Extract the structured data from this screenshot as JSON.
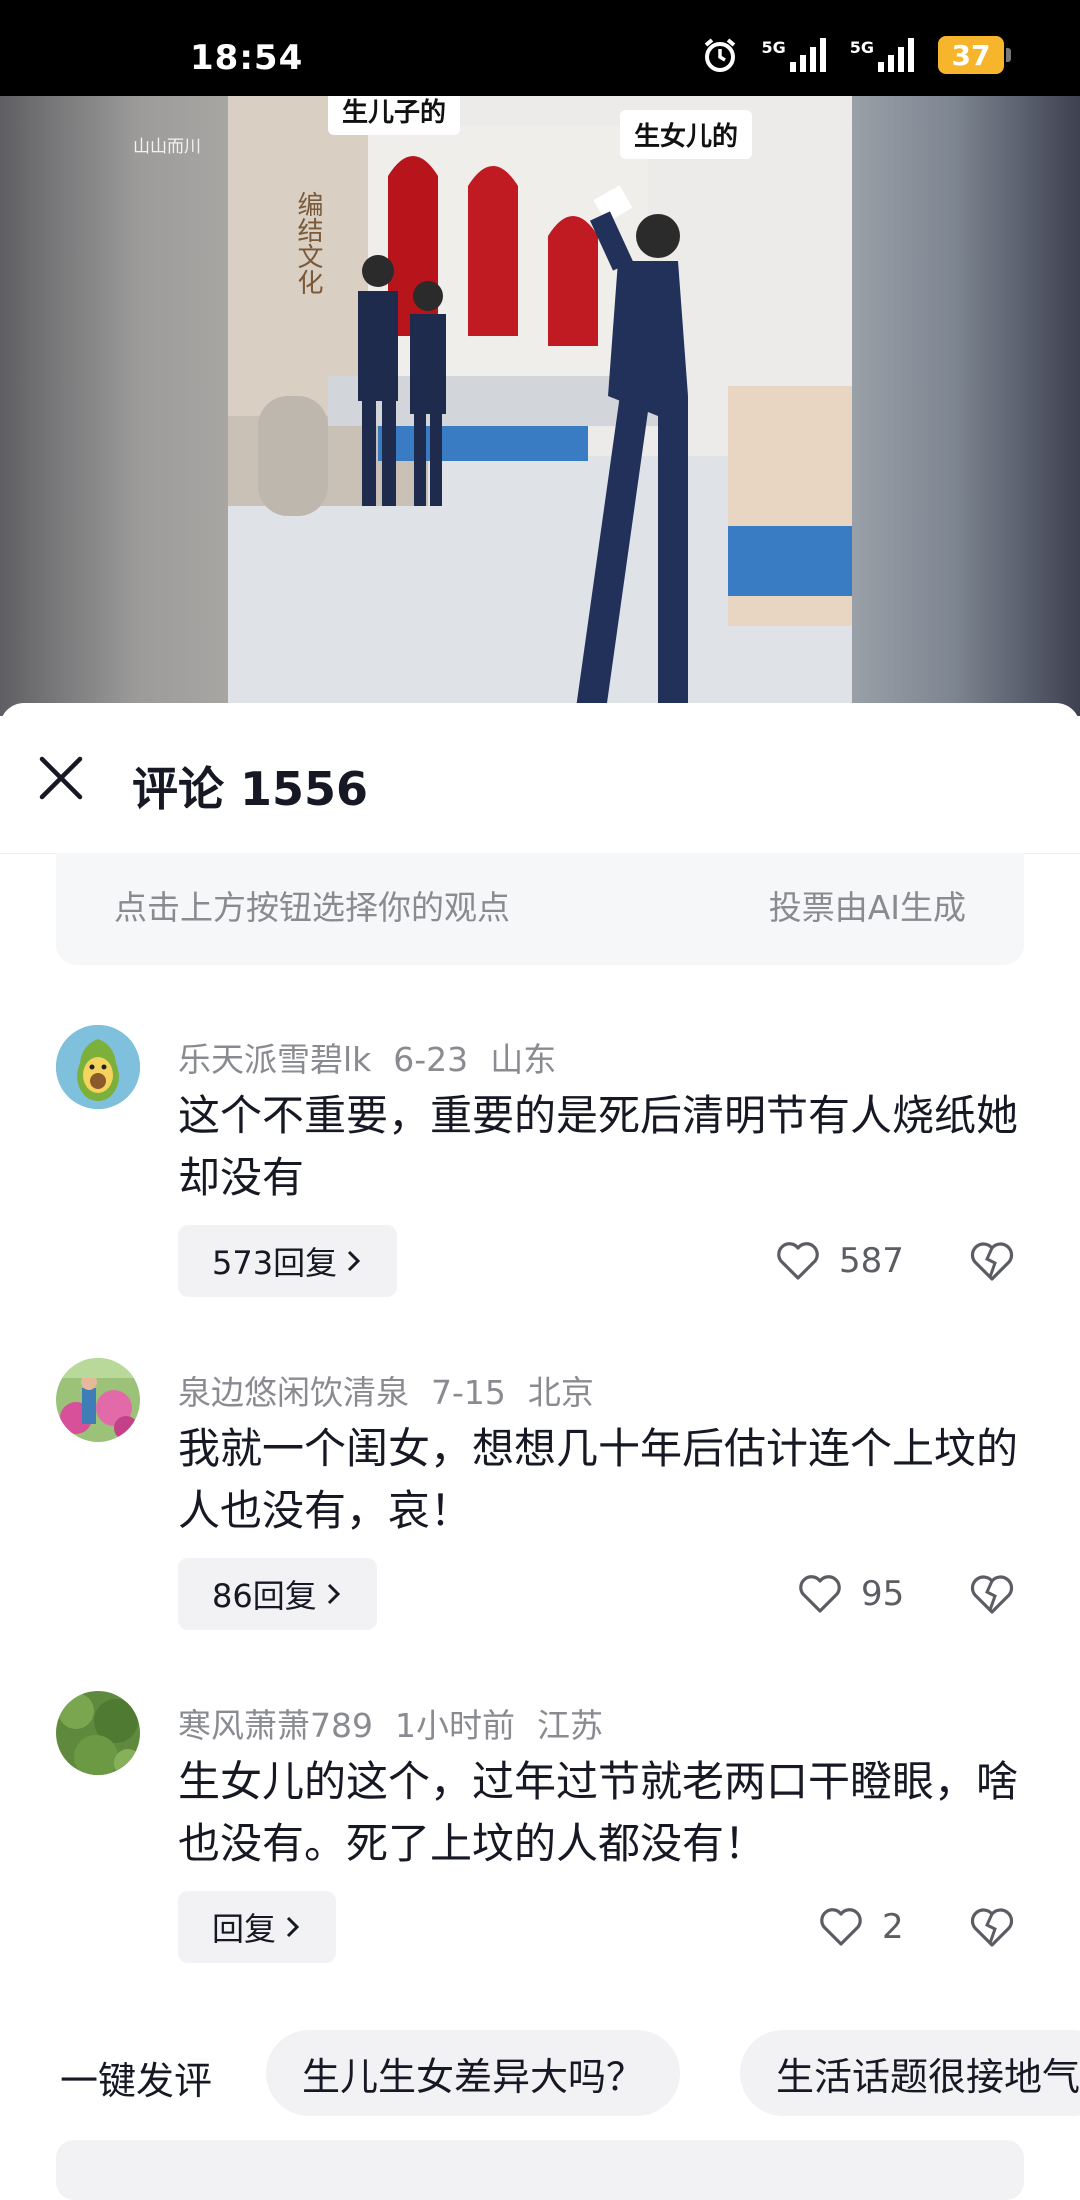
{
  "status_bar": {
    "time": "18:54",
    "network_1": "5G",
    "network_2": "5G",
    "battery": "37",
    "icons": [
      "alarm-icon",
      "signal-icon",
      "signal-icon",
      "battery-icon"
    ],
    "battery_color": "#f7b52c"
  },
  "video": {
    "watermark": "山山而川",
    "caption_top": "生儿子的",
    "caption_right": "生女儿的",
    "wall_text": "编结文化"
  },
  "panel": {
    "title": "评论 1556",
    "close_icon": "close-icon",
    "vote_hint": "点击上方按钮选择你的观点",
    "vote_ai": "投票由AI生成"
  },
  "comments": [
    {
      "user": "乐天派雪碧lk",
      "date": "6-23",
      "location": "山东",
      "text": "这个不重要，重要的是死后清明节有人烧纸她却没有",
      "reply": "573回复",
      "likes": "587"
    },
    {
      "user": "泉边悠闲饮清泉",
      "date": "7-15",
      "location": "北京",
      "text": "我就一个闺女，想想几十年后估计连个上坟的人也没有，哀！",
      "reply": "86回复",
      "likes": "95"
    },
    {
      "user": "寒风萧萧789",
      "date": "1小时前",
      "location": "江苏",
      "text": "生女儿的这个，过年过节就老两口干瞪眼，啥也没有。死了上坟的人都没有！",
      "reply": "回复",
      "likes": "2"
    }
  ],
  "quick_comments": {
    "label": "一键发评",
    "chips": [
      "生儿生女差异大吗？",
      "生活话题很接地气"
    ]
  }
}
